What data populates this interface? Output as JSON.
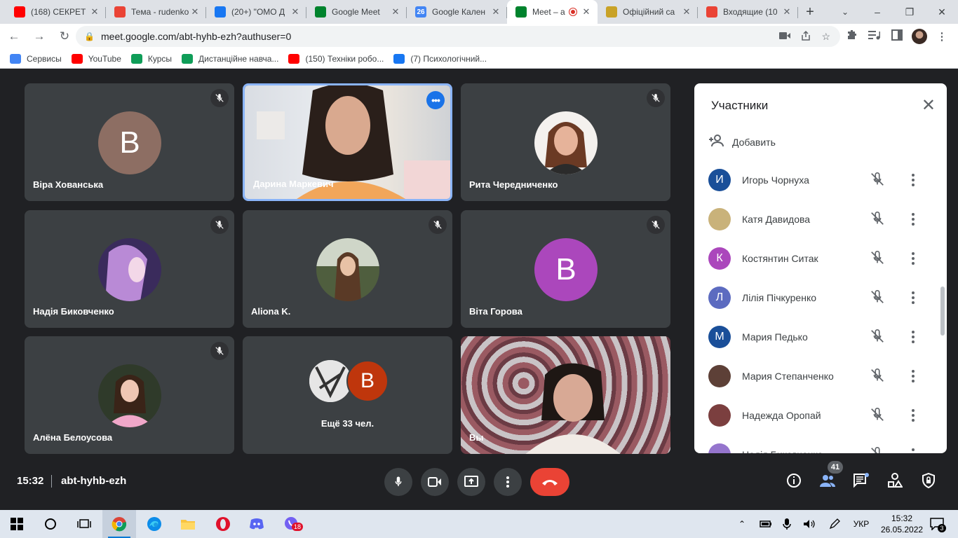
{
  "browser": {
    "tabs": [
      {
        "title": "(168) СЕКРЕТ",
        "favicon": "youtube-icon",
        "color": "#ff0000"
      },
      {
        "title": "Тема - rudenko",
        "favicon": "gmail-icon",
        "color": "#ea4335"
      },
      {
        "title": "(20+) \"ОМО Д",
        "favicon": "facebook-icon",
        "color": "#1877f2"
      },
      {
        "title": "Google Meet",
        "favicon": "meet-icon",
        "color": "#00832d"
      },
      {
        "title": "Google Кален",
        "favicon": "calendar-icon",
        "color": "#4285f4",
        "glyph": "26"
      },
      {
        "title": "Meet – ab",
        "favicon": "meet-icon",
        "color": "#00832d",
        "active": true
      },
      {
        "title": "Офіційний са",
        "favicon": "site-icon",
        "color": "#c9a227"
      },
      {
        "title": "Входящие (10",
        "favicon": "gmail-icon",
        "color": "#ea4335"
      }
    ],
    "url": "meet.google.com/abt-hyhb-ezh?authuser=0",
    "bookmarks": [
      {
        "label": "Сервисы",
        "icon": "apps-grid-icon",
        "color": "#4285f4"
      },
      {
        "label": "YouTube",
        "icon": "youtube-icon",
        "color": "#ff0000"
      },
      {
        "label": "Курсы",
        "icon": "classroom-icon",
        "color": "#0f9d58"
      },
      {
        "label": "Дистанційне навча...",
        "icon": "sheets-icon",
        "color": "#0f9d58"
      },
      {
        "label": "(150) Техніки робо...",
        "icon": "youtube-icon",
        "color": "#ff0000"
      },
      {
        "label": "(7) Психологічний...",
        "icon": "facebook-icon",
        "color": "#1877f2"
      }
    ]
  },
  "meet": {
    "tiles": [
      {
        "name": "Віра Хованська",
        "initial": "В",
        "avatar_color": "#8d6e63",
        "kind": "initial",
        "muted": true
      },
      {
        "name": "Дарина Маркевич",
        "kind": "video",
        "active_speaker": true
      },
      {
        "name": "Рита Чередниченко",
        "kind": "photo",
        "muted": true
      },
      {
        "name": "Надія Биковченко",
        "kind": "photo",
        "muted": true
      },
      {
        "name": "Aliona K.",
        "kind": "photo",
        "muted": true
      },
      {
        "name": "Віта Горова",
        "initial": "В",
        "avatar_color": "#ab47bc",
        "kind": "initial",
        "muted": true
      },
      {
        "name": "Алёна Белоусова",
        "kind": "photo",
        "muted": true
      },
      {
        "label": "Ещё 33 чел.",
        "initial": "В",
        "avatar_color": "#bf360c",
        "kind": "others"
      },
      {
        "name": "Вы",
        "kind": "video"
      }
    ],
    "panel": {
      "title": "Участники",
      "add_label": "Добавить",
      "participants": [
        {
          "name": "Игорь Чорнуха",
          "initial": "И",
          "color": "#1a4f99"
        },
        {
          "name": "Катя Давидова",
          "initial": "",
          "color": "#c9b27a"
        },
        {
          "name": "Костянтин Ситак",
          "initial": "К",
          "color": "#ab47bc"
        },
        {
          "name": "Лілія Пічкуренко",
          "initial": "Л",
          "color": "#5c6bc0"
        },
        {
          "name": "Мария Педько",
          "initial": "М",
          "color": "#1a4f99"
        },
        {
          "name": "Мария Степанченко",
          "initial": "",
          "color": "#5d4037"
        },
        {
          "name": "Надежда Оропай",
          "initial": "",
          "color": "#7b3f3f"
        },
        {
          "name": "Надія Биковченко",
          "initial": "",
          "color": "#9575cd"
        }
      ]
    },
    "bottom": {
      "time": "15:32",
      "code": "abt-hyhb-ezh",
      "participants_count": "41"
    }
  },
  "taskbar": {
    "lang": "УКР",
    "time": "15:32",
    "date": "26.05.2022",
    "viber_badge": "18",
    "notif_count": "3"
  }
}
